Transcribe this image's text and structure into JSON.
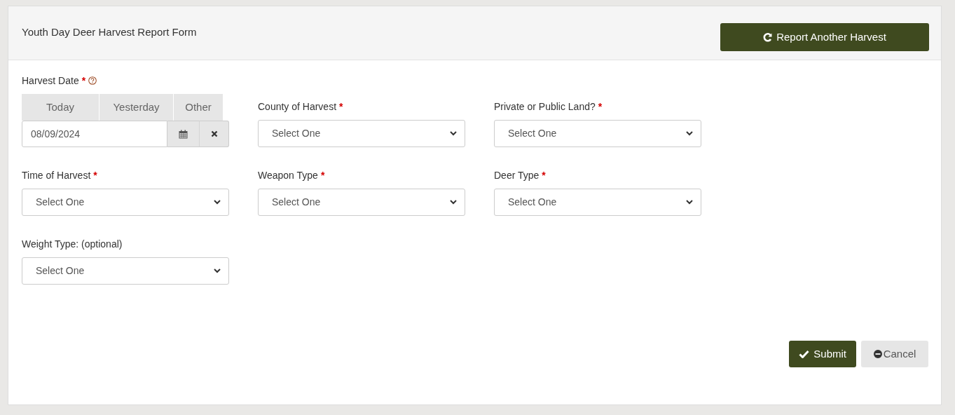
{
  "form": {
    "title": "Youth Day Deer Harvest Report Form",
    "header_button": "Report Another Harvest"
  },
  "fields": [
    {
      "kind": "date",
      "label": "Harvest Date",
      "required_mark": "*",
      "help": true,
      "quick_buttons": [
        "Today",
        "Yesterday",
        "Other"
      ],
      "value": "08/09/2024"
    },
    {
      "kind": "select",
      "label": "County of Harvest",
      "required_mark": "*",
      "value": "Select One"
    },
    {
      "kind": "select",
      "label": "Private or Public Land?",
      "required_mark": "*",
      "value": "Select One"
    },
    {
      "kind": "select",
      "label": "Time of Harvest",
      "required_mark": "*",
      "value": "Select One"
    },
    {
      "kind": "select",
      "label": "Weapon Type",
      "required_mark": "*",
      "value": "Select One"
    },
    {
      "kind": "select",
      "label": "Deer Type",
      "required_mark": "*",
      "value": "Select One"
    },
    {
      "kind": "select",
      "label": "Weight Type: (optional)",
      "value": "Select One"
    }
  ],
  "actions": {
    "submit": "Submit",
    "cancel": "Cancel"
  }
}
